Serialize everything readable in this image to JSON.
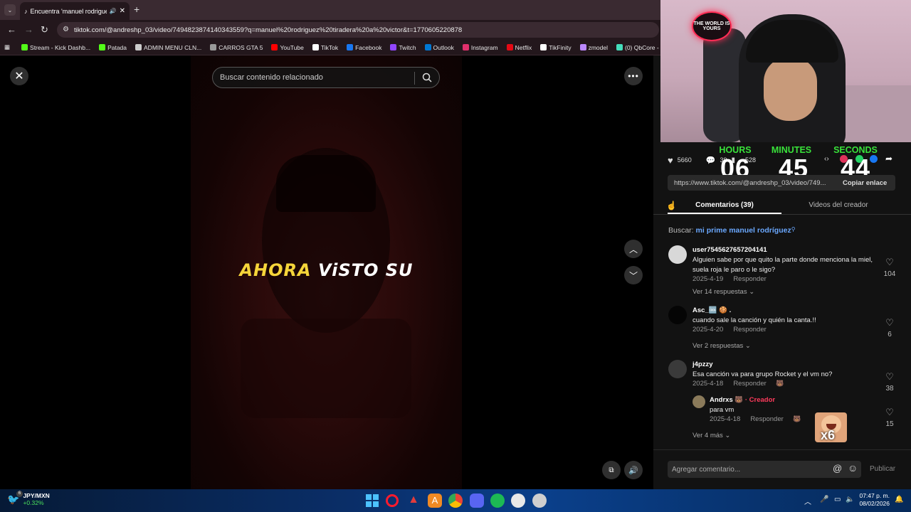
{
  "browser": {
    "tab_title": "Encuentra 'manuel rodrigue",
    "url": "tiktok.com/@andreshp_03/video/7494823874140343559?q=manuel%20rodriguez%20tiradera%20a%20victor&t=1770605220878",
    "bookmarks": [
      {
        "label": "Stream - Kick Dashb...",
        "color": "#53fc18"
      },
      {
        "label": "Patada",
        "color": "#53fc18"
      },
      {
        "label": "ADMIN MENU CLN...",
        "color": "#cccccc"
      },
      {
        "label": "CARROS GTA 5",
        "color": "#999999"
      },
      {
        "label": "YouTube",
        "color": "#ff0000"
      },
      {
        "label": "TikTok",
        "color": "#ffffff"
      },
      {
        "label": "Facebook",
        "color": "#1877f2"
      },
      {
        "label": "Twitch",
        "color": "#9146ff"
      },
      {
        "label": "Outlook",
        "color": "#0078d4"
      },
      {
        "label": "Instagram",
        "color": "#e1306c"
      },
      {
        "label": "Netflix",
        "color": "#e50914"
      },
      {
        "label": "TikFinity",
        "color": "#ffffff"
      },
      {
        "label": "zmodel",
        "color": "#bb88ff"
      },
      {
        "label": "(0) QbCore - Res",
        "color": "#44ddbb"
      }
    ]
  },
  "video": {
    "search_placeholder": "Buscar contenido relacionado",
    "caption_part1": "AHORA",
    "caption_part2": "ViSTO SU"
  },
  "overlay": {
    "badge_text": "THE WORLD IS YOURS",
    "hours_label": "HOURS",
    "minutes_label": "MINUTES",
    "seconds_label": "SECONDS",
    "hours": "06",
    "minutes": "45",
    "seconds": "44",
    "emote_text": "x6"
  },
  "panel": {
    "likes": "5660",
    "comments_count": "39",
    "saves": "528",
    "link": "https://www.tiktok.com/@andreshp_03/video/749...",
    "copy_link": "Copiar enlace",
    "tab_comments": "Comentarios (39)",
    "tab_videos": "Videos del creador",
    "buscar_prefix": "Buscar:",
    "buscar_query": "mi prime manuel rodríguez",
    "comments": [
      {
        "user": "user7545627657204141",
        "text": "Alguien sabe por que quito la parte donde menciona la miel, suela roja le paro o le sigo?",
        "date": "2025-4-19",
        "reply": "Responder",
        "likes": "104",
        "more": "Ver 14 respuestas"
      },
      {
        "user": "Asc_🆒 🍪 .",
        "text": "cuando sale la canción y quién la canta.!!",
        "date": "2025-4-20",
        "reply": "Responder",
        "likes": "6",
        "more": "Ver 2 respuestas"
      },
      {
        "user": "j4pzzy",
        "text": "Esa canción va para grupo Rocket y el vm no?",
        "date": "2025-4-18",
        "reply": "Responder",
        "likes": "38",
        "more": ""
      }
    ],
    "reply": {
      "user": "Andrxs 🐻",
      "creator_tag": "· Creador",
      "text": "para vm",
      "date": "2025-4-18",
      "reply": "Responder",
      "likes": "15",
      "more": "Ver 4 más"
    },
    "comment_placeholder": "Agregar comentario...",
    "publish": "Publicar"
  },
  "taskbar": {
    "pair": "JPY/MXN",
    "change": "+0.32%",
    "time": "07:47 p. m.",
    "date": "08/02/2026",
    "notif_count": "6"
  }
}
